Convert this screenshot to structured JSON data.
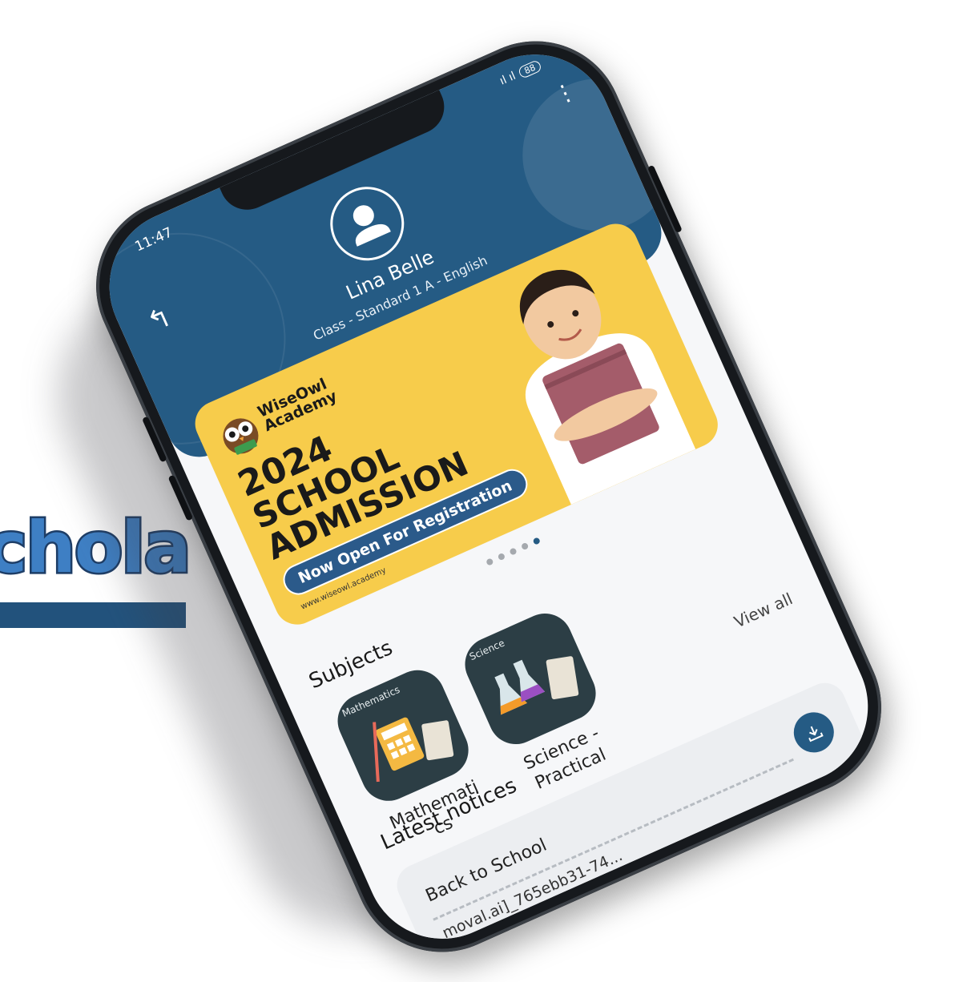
{
  "brand": {
    "word": "chola"
  },
  "status_bar": {
    "time": "11:47",
    "signal": "ıl ıl",
    "battery": "88"
  },
  "header": {
    "back_icon": "back-arrow-icon",
    "menu_icon": "kebab-menu-icon",
    "avatar_icon": "user-avatar-icon",
    "user_name": "Lina Belle",
    "user_class": "Class - Standard 1 A - English"
  },
  "banner": {
    "academy": [
      "WiseOwl",
      "Academy"
    ],
    "year": "2024",
    "line1": "SCHOOL",
    "line2": "ADMISSION",
    "pill": "Now Open For Registration",
    "website": "www.wiseowl.academy",
    "dots_total": 5,
    "dots_active": 4
  },
  "subjects": {
    "title": "Subjects",
    "view_all": "View all",
    "items": [
      {
        "tag": "Mathematics",
        "label_line1": "Mathemati",
        "label_line2": "cs"
      },
      {
        "tag": "Science",
        "label_line1": "Science -",
        "label_line2": "Practical"
      }
    ]
  },
  "notices": {
    "title": "Latest notices",
    "items": [
      {
        "title": "Back to School",
        "file": "moval.ai]_765ebb31-74..."
      }
    ]
  },
  "colors": {
    "primary": "#255b84",
    "banner": "#f7cc4b",
    "brand_text": "#3e7fc4"
  }
}
